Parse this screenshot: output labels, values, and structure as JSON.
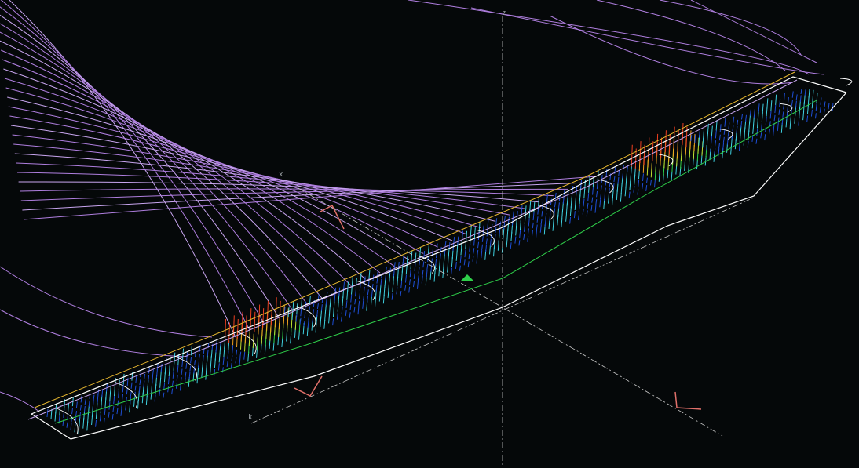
{
  "viewport": {
    "background": "#050809",
    "axes": {
      "z_label": "z",
      "x_label": "x",
      "k_label": "k"
    },
    "colors": {
      "streamline": "#b07fe0",
      "streamline_light": "#c9a6f0",
      "wing_outline": "#ffffff",
      "leading_edge": "#e8b830",
      "spar": "#2fcf4a",
      "triad": "#e0706a",
      "axis": "#c8c8c8",
      "vector_low": "#1e4fd8",
      "vector_mid": "#3fd0e0",
      "vector_high": "#f04020"
    },
    "icons": [
      "origin-marker-icon",
      "view-triad-icon",
      "local-frame-icon"
    ]
  }
}
